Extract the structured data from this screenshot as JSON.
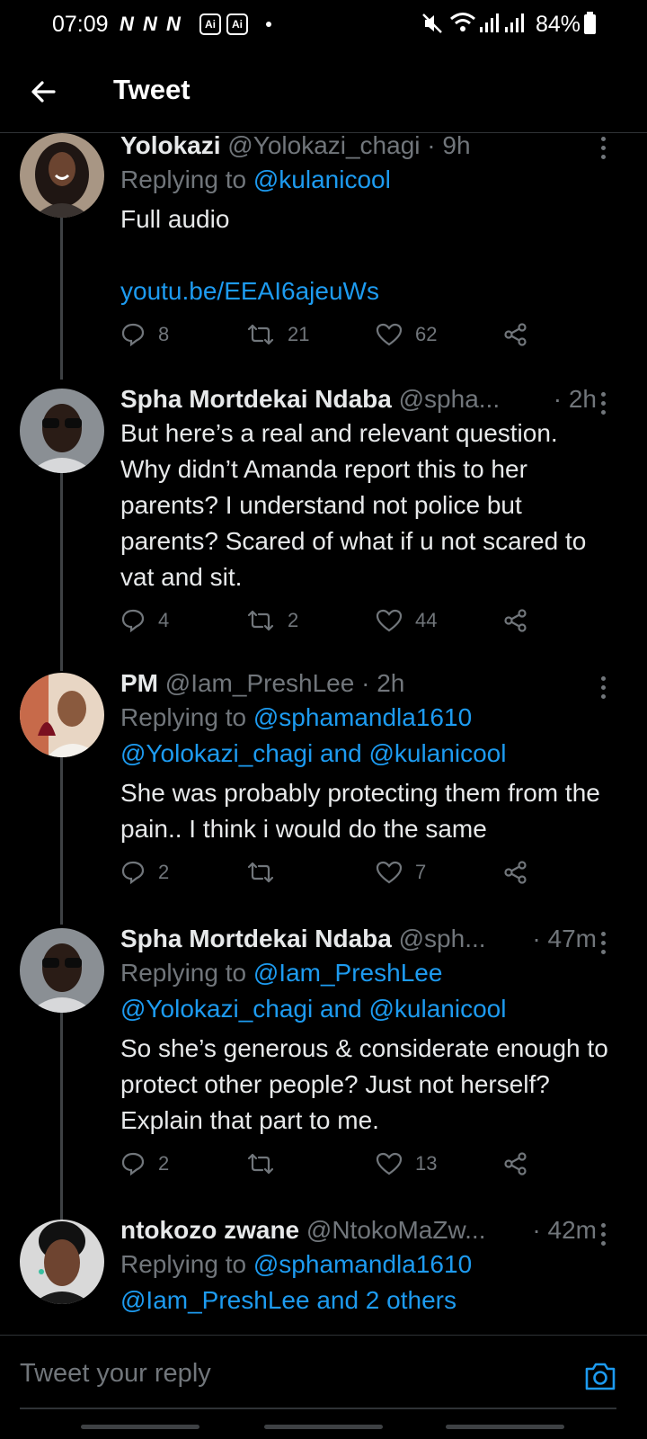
{
  "status_bar": {
    "time": "07:09",
    "notif_letters": "N N N",
    "ai_badge": "Ai",
    "battery": "84%"
  },
  "header": {
    "title": "Tweet"
  },
  "tweets": [
    {
      "name": "Yolokazi",
      "handle": "@Yolokazi_chagi",
      "time": "· 9h",
      "replying_label": "Replying to",
      "replying_to": "@kulanicool",
      "text": "Full audio",
      "link": "youtu.be/EEAI6ajeuWs",
      "replies": "8",
      "retweets": "21",
      "likes": "62"
    },
    {
      "name": "Spha Mortdekai Ndaba",
      "handle": "@spha...",
      "time": "· 2h",
      "text": "But here’s a real and relevant question. Why didn’t Amanda report this to her parents? I understand not police but parents? Scared of what if u not scared to vat and sit.",
      "replies": "4",
      "retweets": "2",
      "likes": "44"
    },
    {
      "name": "PM",
      "handle": "@Iam_PreshLee",
      "time": "· 2h",
      "replying_label": "Replying to",
      "replying_to": "@sphamandla1610",
      "replying_line2": "@Yolokazi_chagi",
      "replying_and": "and",
      "replying_line2b": "@kulanicool",
      "text": "She was probably protecting them from the pain.. I think i would do the same",
      "replies": "2",
      "retweets": "",
      "likes": "7"
    },
    {
      "name": "Spha Mortdekai Ndaba",
      "handle": "@sph...",
      "time": "· 47m",
      "replying_label": "Replying to",
      "replying_to": "@Iam_PreshLee",
      "replying_line2": "@Yolokazi_chagi",
      "replying_and": "and",
      "replying_line2b": "@kulanicool",
      "text": "So she’s generous & considerate enough to protect other people? Just not herself? Explain that part to me.",
      "replies": "2",
      "retweets": "",
      "likes": "13"
    },
    {
      "name": "ntokozo zwane",
      "handle": "@NtokoMaZw...",
      "time": "· 42m",
      "replying_label": "Replying to",
      "replying_to": "@sphamandla1610",
      "replying_line2": "@Iam_PreshLee and 2 others"
    }
  ],
  "reply_bar": {
    "placeholder": "Tweet your reply"
  },
  "colors": {
    "background": "#000000",
    "text": "#e7e9ea",
    "muted": "#71767b",
    "accent": "#1d9bf0"
  }
}
